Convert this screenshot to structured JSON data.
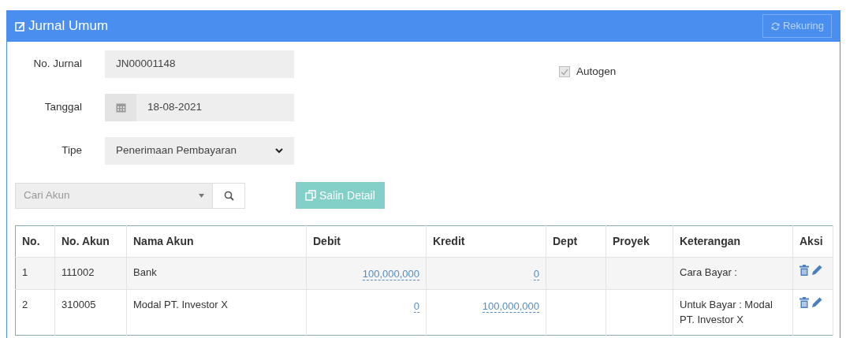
{
  "panel": {
    "title": "Jurnal Umum",
    "rekuring_button": {
      "label": "Rekuring",
      "disabled": true
    }
  },
  "form": {
    "fields": [
      {
        "kind": "text",
        "label": "No. Jurnal",
        "value": "JN00001148"
      },
      {
        "kind": "date",
        "label": "Tanggal",
        "value": "18-08-2021"
      },
      {
        "kind": "select",
        "label": "Tipe",
        "value": "Penerimaan Pembayaran"
      }
    ],
    "autogen": {
      "label": "Autogen",
      "checked": true,
      "disabled": true
    }
  },
  "account_search": {
    "placeholder": "Cari Akun"
  },
  "copy_button": {
    "label": "Salin Detail",
    "disabled": true
  },
  "table": {
    "columns": [
      "No.",
      "No. Akun",
      "Nama Akun",
      "Debit",
      "Kredit",
      "Dept",
      "Proyek",
      "Keterangan",
      "Aksi"
    ],
    "rows": [
      {
        "no": "1",
        "account_no": "111002",
        "account_name": "Bank",
        "debit": "100,000,000",
        "credit": "0",
        "note": "Cara Bayar :"
      },
      {
        "no": "2",
        "account_no": "310005",
        "account_name": "Modal PT. Investor X",
        "debit": "0",
        "credit": "100,000,000",
        "note": "Untuk Bayar : Modal PT. Investor X"
      }
    ]
  }
}
